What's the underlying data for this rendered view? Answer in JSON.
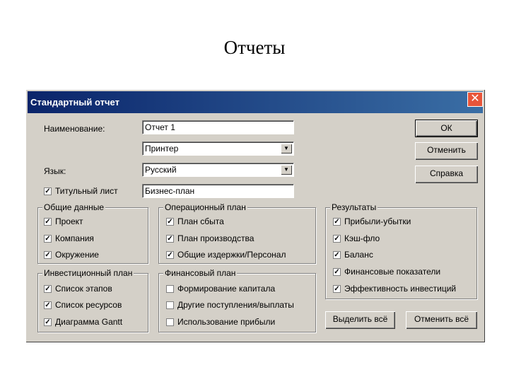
{
  "slide_title": "Отчеты",
  "dialog": {
    "title": "Стандартный отчет",
    "name_label": "Наименование:",
    "name_value": "Отчет 1",
    "printer_value": "Принтер",
    "language_label": "Язык:",
    "language_value": "Русский",
    "title_page_label": "Титульный лист",
    "title_page_checked": true,
    "title_page_value": "Бизнес-план",
    "buttons": {
      "ok": "ОК",
      "cancel": "Отменить",
      "help": "Справка",
      "select_all": "Выделить всё",
      "deselect_all": "Отменить всё"
    },
    "groups": {
      "general": {
        "title": "Общие данные",
        "items": [
          {
            "label": "Проект",
            "checked": true
          },
          {
            "label": "Компания",
            "checked": true
          },
          {
            "label": "Окружение",
            "checked": true
          }
        ]
      },
      "operational": {
        "title": "Операционный план",
        "items": [
          {
            "label": "План сбыта",
            "checked": true
          },
          {
            "label": "План производства",
            "checked": true
          },
          {
            "label": "Общие издержки/Персонал",
            "checked": true
          }
        ]
      },
      "results": {
        "title": "Результаты",
        "items": [
          {
            "label": "Прибыли-убытки",
            "checked": true
          },
          {
            "label": "Кэш-фло",
            "checked": true
          },
          {
            "label": "Баланс",
            "checked": true
          },
          {
            "label": "Финансовые показатели",
            "checked": true
          },
          {
            "label": "Эффективность инвестиций",
            "checked": true
          }
        ]
      },
      "investment": {
        "title": "Инвестиционный план",
        "items": [
          {
            "label": "Список этапов",
            "checked": true
          },
          {
            "label": "Список ресурсов",
            "checked": true
          },
          {
            "label": "Диаграмма Gantt",
            "checked": true
          }
        ]
      },
      "financial": {
        "title": "Финансовый план",
        "items": [
          {
            "label": "Формирование капитала",
            "checked": false
          },
          {
            "label": "Другие поступления/выплаты",
            "checked": false
          },
          {
            "label": "Использование прибыли",
            "checked": false
          }
        ]
      }
    }
  }
}
